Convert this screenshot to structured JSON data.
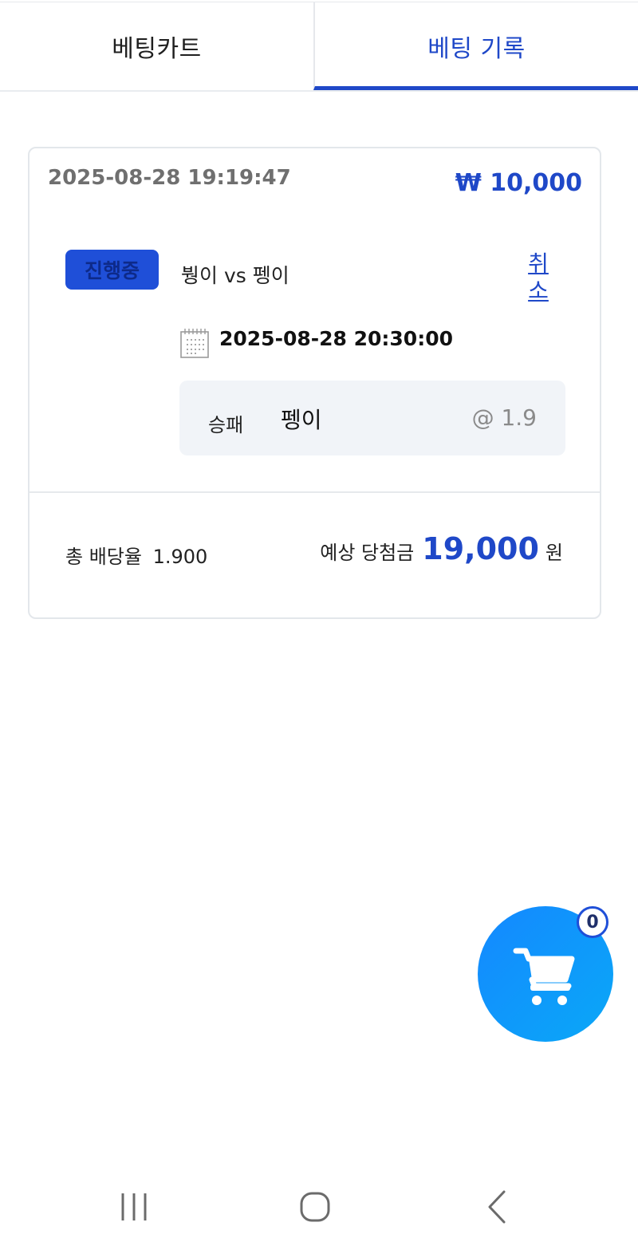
{
  "tabs": {
    "cart_label": "베팅카트",
    "history_label": "베팅 기록"
  },
  "colors": {
    "accent": "#1f48c8",
    "badge": "#1f4fd8",
    "cart_fab": "#0f98fb"
  },
  "bet": {
    "placed_at": "2025-08-28 19:19:47",
    "amount": "₩ 10,000",
    "status": "진행중",
    "match": "붱이 vs 펭이",
    "cancel_label": "취소",
    "match_datetime": "2025-08-28 20:30:00",
    "pick": {
      "market": "승패",
      "selection": "펭이",
      "odds": "@ 1.9"
    },
    "total_odds_label": "총 배당율",
    "total_odds_value": "1.900",
    "expected_label": "예상 당첨금",
    "expected_amount": "19,000",
    "currency_unit": "원"
  },
  "cart": {
    "count": "0",
    "icon": "cart-icon"
  },
  "system_nav": {
    "icons": [
      "recent-apps-icon",
      "home-icon",
      "back-icon"
    ]
  }
}
